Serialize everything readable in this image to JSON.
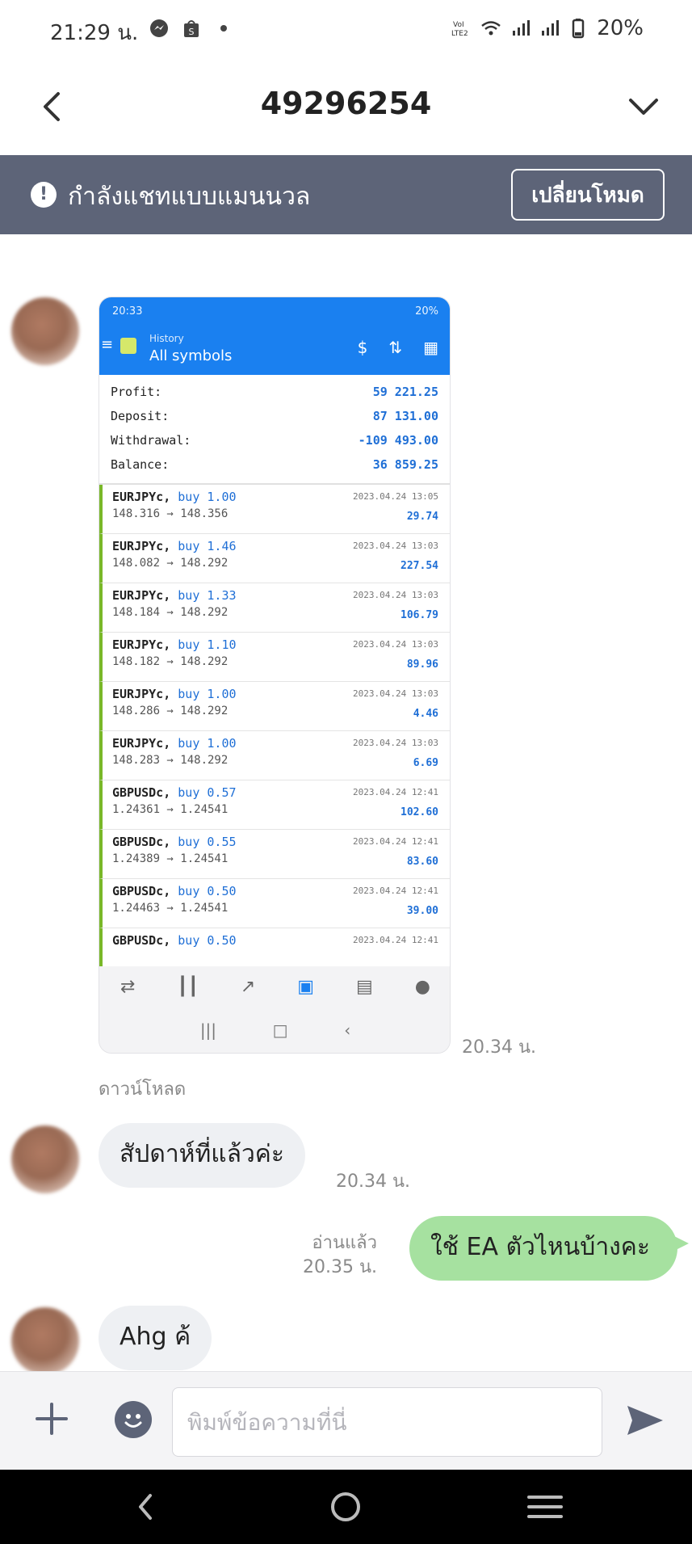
{
  "status_bar": {
    "time": "21:29 น.",
    "battery": "20%",
    "icons": [
      "messenger-icon",
      "shopping-bag-icon",
      "dot-icon",
      "volte-icon",
      "wifi-icon",
      "signal-icon",
      "signal-icon",
      "battery-icon"
    ]
  },
  "header": {
    "title": "49296254"
  },
  "banner": {
    "text": "กำลังแชทแบบแมนนวล",
    "button_label": "เปลี่ยนโหมด"
  },
  "screenshot": {
    "status_time": "20:33",
    "status_right": "20%",
    "section": "History",
    "filter": "All symbols",
    "summary": [
      {
        "label": "Profit:",
        "value": "59 221.25"
      },
      {
        "label": "Deposit:",
        "value": "87 131.00"
      },
      {
        "label": "Withdrawal:",
        "value": "-109 493.00"
      },
      {
        "label": "Balance:",
        "value": "36 859.25"
      }
    ],
    "trades": [
      {
        "pair": "EURJPYc,",
        "dir": "buy 1.00",
        "prices": "148.316 → 148.356",
        "date": "2023.04.24 13:05",
        "profit": "29.74"
      },
      {
        "pair": "EURJPYc,",
        "dir": "buy 1.46",
        "prices": "148.082 → 148.292",
        "date": "2023.04.24 13:03",
        "profit": "227.54"
      },
      {
        "pair": "EURJPYc,",
        "dir": "buy 1.33",
        "prices": "148.184 → 148.292",
        "date": "2023.04.24 13:03",
        "profit": "106.79"
      },
      {
        "pair": "EURJPYc,",
        "dir": "buy 1.10",
        "prices": "148.182 → 148.292",
        "date": "2023.04.24 13:03",
        "profit": "89.96"
      },
      {
        "pair": "EURJPYc,",
        "dir": "buy 1.00",
        "prices": "148.286 → 148.292",
        "date": "2023.04.24 13:03",
        "profit": "4.46"
      },
      {
        "pair": "EURJPYc,",
        "dir": "buy 1.00",
        "prices": "148.283 → 148.292",
        "date": "2023.04.24 13:03",
        "profit": "6.69"
      },
      {
        "pair": "GBPUSDc,",
        "dir": "buy 0.57",
        "prices": "1.24361 → 1.24541",
        "date": "2023.04.24 12:41",
        "profit": "102.60"
      },
      {
        "pair": "GBPUSDc,",
        "dir": "buy 0.55",
        "prices": "1.24389 → 1.24541",
        "date": "2023.04.24 12:41",
        "profit": "83.60"
      },
      {
        "pair": "GBPUSDc,",
        "dir": "buy 0.50",
        "prices": "1.24463 → 1.24541",
        "date": "2023.04.24 12:41",
        "profit": "39.00"
      },
      {
        "pair": "GBPUSDc,",
        "dir": "buy 0.50",
        "prices": "",
        "date": "2023.04.24 12:41",
        "profit": ""
      }
    ]
  },
  "messages": {
    "image_time": "20.34 น.",
    "download_label": "ดาวน์โหลด",
    "msg1": {
      "text": "สัปดาห์ที่แล้วค่ะ",
      "time": "20.34 น."
    },
    "msg2": {
      "text": "ใช้ EA ตัวไหนบ้างคะ",
      "read": "อ่านแล้ว",
      "time": "20.35 น."
    },
    "msg3": {
      "text": "Ahg ค้"
    }
  },
  "input": {
    "placeholder": "พิมพ์ข้อความที่นี่"
  },
  "colors": {
    "banner": "#5d6478",
    "outgoing_bubble": "#a6e1a0",
    "incoming_bubble": "#eef0f3",
    "mt_blue": "#1a80f0"
  }
}
